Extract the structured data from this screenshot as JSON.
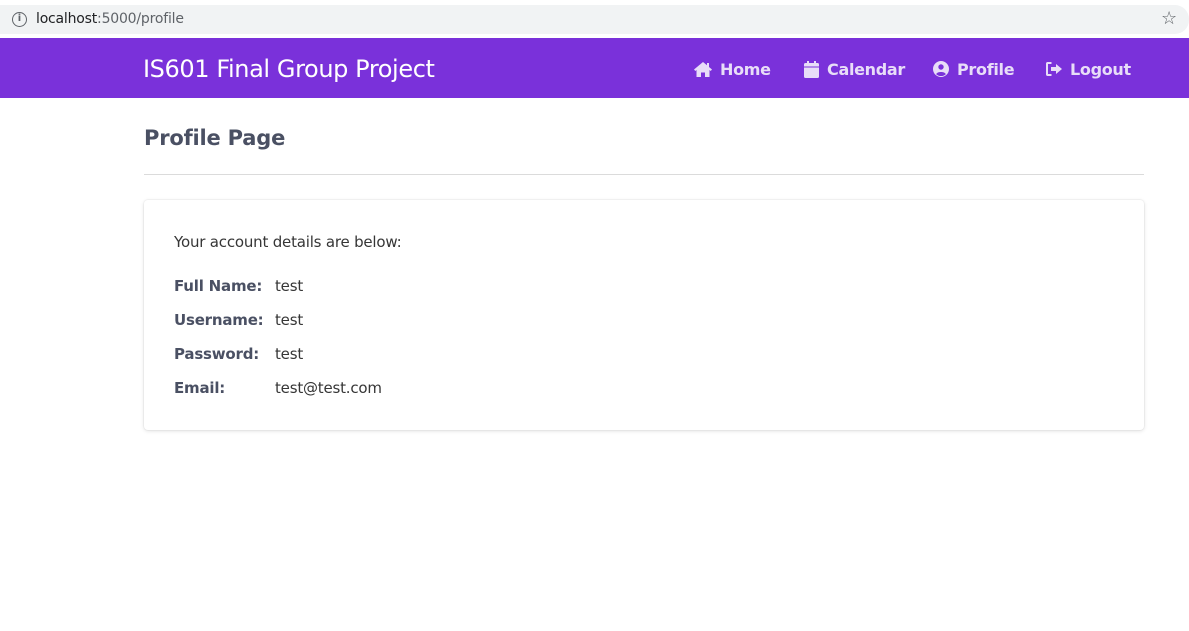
{
  "browser": {
    "url_host": "localhost",
    "url_path": ":5000/profile"
  },
  "navbar": {
    "brand": "IS601 Final Group Project",
    "accent_color": "#7a31da",
    "items": [
      {
        "label": "Home",
        "icon": "home-icon"
      },
      {
        "label": "Calendar",
        "icon": "calendar-icon"
      },
      {
        "label": "Profile",
        "icon": "user-circle-icon"
      },
      {
        "label": "Logout",
        "icon": "sign-out-icon"
      }
    ]
  },
  "page": {
    "title": "Profile Page"
  },
  "card": {
    "intro": "Your account details are below:",
    "details": [
      {
        "label": "Full Name:",
        "value": "test"
      },
      {
        "label": "Username:",
        "value": "test"
      },
      {
        "label": "Password:",
        "value": "test"
      },
      {
        "label": "Email:",
        "value": "test@test.com"
      }
    ]
  }
}
